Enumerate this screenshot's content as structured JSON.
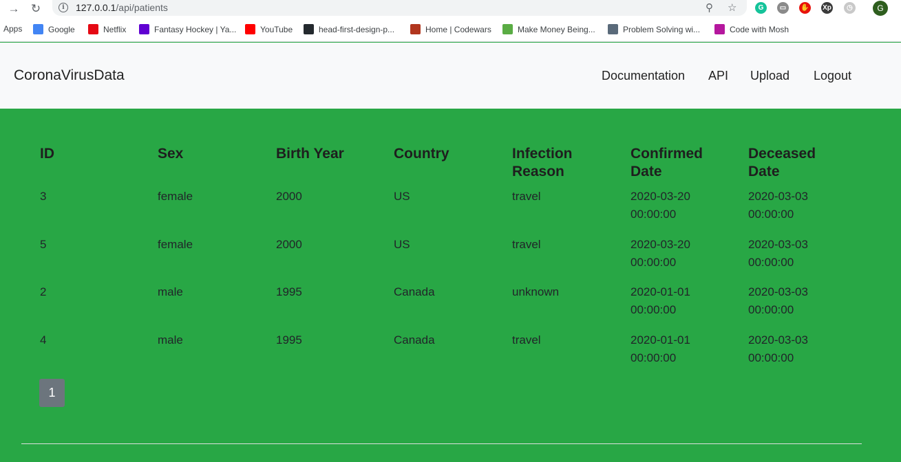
{
  "browser": {
    "url_host": "127.0.0.1",
    "url_path": "/api/patients",
    "avatar_letter": "G",
    "extensions": [
      {
        "name": "grammarly-icon",
        "glyph": "G",
        "color": "#15c39a"
      },
      {
        "name": "extension-box-icon",
        "glyph": "▭",
        "color": "#8a8a8a"
      },
      {
        "name": "adblock-icon",
        "glyph": "✋",
        "color": "#e8120c"
      },
      {
        "name": "xp-icon",
        "glyph": "Xp",
        "color": "#3b3b3b"
      },
      {
        "name": "timer-icon",
        "glyph": "◷",
        "color": "#c9c9c9"
      }
    ]
  },
  "bookmarks": [
    {
      "label": "Apps",
      "icon": "apps-icon",
      "color": ""
    },
    {
      "label": "Google",
      "icon": "google-icon",
      "color": "#4285f4"
    },
    {
      "label": "Netflix",
      "icon": "netflix-icon",
      "color": "#e50914"
    },
    {
      "label": "Fantasy Hockey | Ya...",
      "icon": "yahoo-icon",
      "color": "#6001d2"
    },
    {
      "label": "YouTube",
      "icon": "youtube-icon",
      "color": "#ff0000"
    },
    {
      "label": "head-first-design-p...",
      "icon": "github-icon",
      "color": "#24292e"
    },
    {
      "label": "Home | Codewars",
      "icon": "codewars-icon",
      "color": "#b1361e"
    },
    {
      "label": "Make Money Being...",
      "icon": "trello-icon",
      "color": "#5aac44"
    },
    {
      "label": "Problem Solving wi...",
      "icon": "book-icon",
      "color": "#5a6a7a"
    },
    {
      "label": "Code with Mosh",
      "icon": "mosh-icon",
      "color": "#b5179e"
    }
  ],
  "navbar": {
    "brand": "CoronaVirusData",
    "links": [
      "Documentation",
      "API",
      "Upload",
      "Logout"
    ]
  },
  "table": {
    "headers": [
      [
        "ID",
        ""
      ],
      [
        "Sex",
        ""
      ],
      [
        "Birth Year",
        ""
      ],
      [
        "Country",
        ""
      ],
      [
        "Infection",
        "Reason"
      ],
      [
        "Confirmed",
        "Date"
      ],
      [
        "Deceased",
        "Date"
      ]
    ],
    "rows": [
      [
        [
          "3",
          ""
        ],
        [
          "female",
          ""
        ],
        [
          "2000",
          ""
        ],
        [
          "US",
          ""
        ],
        [
          "travel",
          ""
        ],
        [
          "2020-03-20",
          "00:00:00"
        ],
        [
          "2020-03-03",
          "00:00:00"
        ]
      ],
      [
        [
          "5",
          ""
        ],
        [
          "female",
          ""
        ],
        [
          "2000",
          ""
        ],
        [
          "US",
          ""
        ],
        [
          "travel",
          ""
        ],
        [
          "2020-03-20",
          "00:00:00"
        ],
        [
          "2020-03-03",
          "00:00:00"
        ]
      ],
      [
        [
          "2",
          ""
        ],
        [
          "male",
          ""
        ],
        [
          "1995",
          ""
        ],
        [
          "Canada",
          ""
        ],
        [
          "unknown",
          ""
        ],
        [
          "2020-01-01",
          "00:00:00"
        ],
        [
          "2020-03-03",
          "00:00:00"
        ]
      ],
      [
        [
          "4",
          ""
        ],
        [
          "male",
          ""
        ],
        [
          "1995",
          ""
        ],
        [
          "Canada",
          ""
        ],
        [
          "travel",
          ""
        ],
        [
          "2020-01-01",
          "00:00:00"
        ],
        [
          "2020-03-03",
          "00:00:00"
        ]
      ]
    ]
  },
  "pagination": {
    "current": "1"
  },
  "colors": {
    "background": "#28a745",
    "navbar": "#f8f9fa",
    "page_button": "#6c757d"
  }
}
